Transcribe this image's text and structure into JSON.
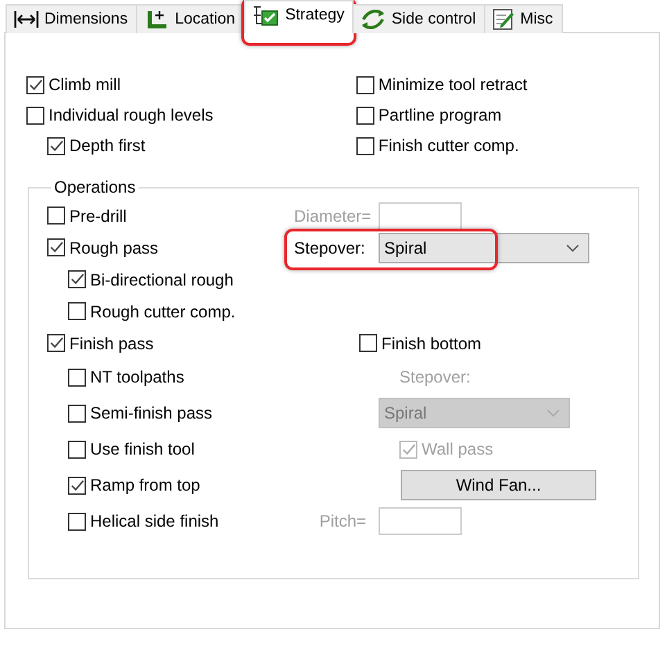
{
  "tabs": [
    {
      "label": "Dimensions",
      "selected": false,
      "highlighted": false
    },
    {
      "label": "Location",
      "selected": false,
      "highlighted": false
    },
    {
      "label": "Strategy",
      "selected": true,
      "highlighted": true
    },
    {
      "label": "Side control",
      "selected": false,
      "highlighted": false
    },
    {
      "label": "Misc",
      "selected": false,
      "highlighted": false
    }
  ],
  "general": {
    "left": [
      {
        "label": "Climb mill",
        "checked": true
      },
      {
        "label": "Individual rough levels",
        "checked": false,
        "children": [
          {
            "label": "Depth first",
            "checked": true
          }
        ]
      }
    ],
    "right": [
      {
        "label": "Minimize tool retract",
        "checked": false
      },
      {
        "label": "Partline program",
        "checked": false
      },
      {
        "label": "Finish cutter comp.",
        "checked": false
      }
    ]
  },
  "operations": {
    "title": "Operations",
    "left": [
      {
        "label": "Pre-drill",
        "checked": false
      },
      {
        "label": "Rough pass",
        "checked": true,
        "children": [
          {
            "label": "Bi-directional rough",
            "checked": true
          },
          {
            "label": "Rough cutter comp.",
            "checked": false
          }
        ]
      },
      {
        "label": "Finish pass",
        "checked": true,
        "children": [
          {
            "label": "NT toolpaths",
            "checked": false
          },
          {
            "label": "Semi-finish pass",
            "checked": false
          },
          {
            "label": "Use finish tool",
            "checked": false
          },
          {
            "label": "Ramp from top",
            "checked": true
          },
          {
            "label": "Helical side finish",
            "checked": false
          }
        ]
      }
    ],
    "right": [
      {
        "kind": "field",
        "label": "Diameter=",
        "disabled": true
      },
      {
        "kind": "combo",
        "label": "Stepover:",
        "value": "Spiral",
        "disabled": false,
        "highlighted": true
      },
      {
        "kind": "checkbox",
        "label": "Finish bottom",
        "checked": false,
        "disabled": false
      },
      {
        "kind": "label",
        "label": "Stepover:",
        "disabled": true
      },
      {
        "kind": "combo",
        "value": "Spiral",
        "disabled": true,
        "highlighted": false
      },
      {
        "kind": "checkbox",
        "label": "Wall pass",
        "checked": true,
        "disabled": true
      },
      {
        "kind": "button",
        "label": "Wind Fan..."
      },
      {
        "kind": "field",
        "label": "Pitch=",
        "disabled": true
      }
    ]
  }
}
